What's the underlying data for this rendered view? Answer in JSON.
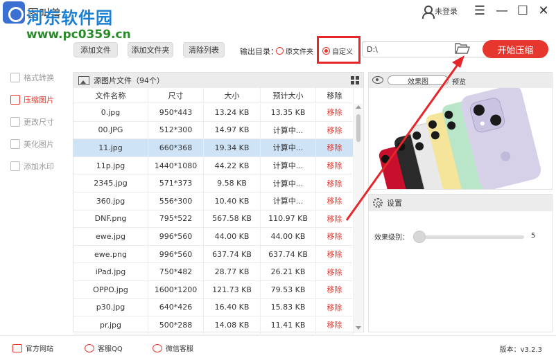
{
  "window": {
    "title": "图叫兽",
    "user_label": "未登录",
    "menu_icon": "hamburger-icon",
    "minimize_icon": "minimize-icon",
    "maximize_icon": "maximize-icon",
    "close_icon": "close-icon"
  },
  "watermark": {
    "line1": "河东软件园",
    "line2": "www.pc0359.cn"
  },
  "sidebar": {
    "items": [
      {
        "label": "格式转换",
        "icon": "convert-icon",
        "active": false
      },
      {
        "label": "压缩图片",
        "icon": "compress-icon",
        "active": true
      },
      {
        "label": "更改尺寸",
        "icon": "resize-icon",
        "active": false
      },
      {
        "label": "美化图片",
        "icon": "beautify-icon",
        "active": false
      },
      {
        "label": "添加水印",
        "icon": "watermark-icon",
        "active": false
      }
    ]
  },
  "toolbar": {
    "add_file": "添加文件",
    "add_folder": "添加文件夹",
    "clear_list": "清除列表",
    "output_label": "输出目录：",
    "radio_original": "原文件夹",
    "radio_custom": "自定义",
    "selected_radio": "自定义",
    "path_value": "D:\\",
    "start_button": "开始压缩"
  },
  "file_list": {
    "header": "源图片文件（94个）",
    "columns": [
      "文件名称",
      "尺寸",
      "大小",
      "预计大小",
      "移除"
    ],
    "rows": [
      [
        "0.jpg",
        "950*443",
        "13.24 KB",
        "13.35 KB",
        "移除"
      ],
      [
        "00.JPG",
        "512*300",
        "14.97 KB",
        "计算中...",
        "移除"
      ],
      [
        "11.jpg",
        "660*368",
        "19.34 KB",
        "计算中...",
        "移除"
      ],
      [
        "11p.jpg",
        "1440*1080",
        "44.22 KB",
        "计算中...",
        "移除"
      ],
      [
        "2345.jpg",
        "571*373",
        "9.58 KB",
        "计算中...",
        "移除"
      ],
      [
        "360.jpg",
        "556*300",
        "10.40 KB",
        "计算中...",
        "移除"
      ],
      [
        "DNF.png",
        "795*522",
        "567.58 KB",
        "110.97 KB",
        "移除"
      ],
      [
        "ewe.jpg",
        "996*560",
        "44.00 KB",
        "44.00 KB",
        "移除"
      ],
      [
        "ewe.png",
        "996*560",
        "637.74 KB",
        "637.74 KB",
        "移除"
      ],
      [
        "iPad.jpg",
        "750*482",
        "28.77 KB",
        "26.21 KB",
        "移除"
      ],
      [
        "OPPO.jpg",
        "1600*1200",
        "121.73 KB",
        "79.53 KB",
        "移除"
      ],
      [
        "p30.jpg",
        "640*426",
        "16.40 KB",
        "15.83 KB",
        "移除"
      ],
      [
        "pr.jpg",
        "500*288",
        "14.08 KB",
        "11.41 KB",
        "移除"
      ]
    ],
    "selected_index": 2
  },
  "preview": {
    "toggle_label": "效果图",
    "label": "预览",
    "image": "iphone-11-colors-image"
  },
  "settings": {
    "title": "设置",
    "level_label": "效果级别：",
    "level_value": "5",
    "level_fraction": 0
  },
  "footer": {
    "website": "官方网站",
    "qq": "客服QQ",
    "wechat": "微信客服",
    "version": "版本：v3.2.3"
  },
  "colors": {
    "accent": "#e5372d",
    "selected_row": "#cfe3f7",
    "header_bg": "#ececec",
    "annotation": "#e5262b"
  }
}
